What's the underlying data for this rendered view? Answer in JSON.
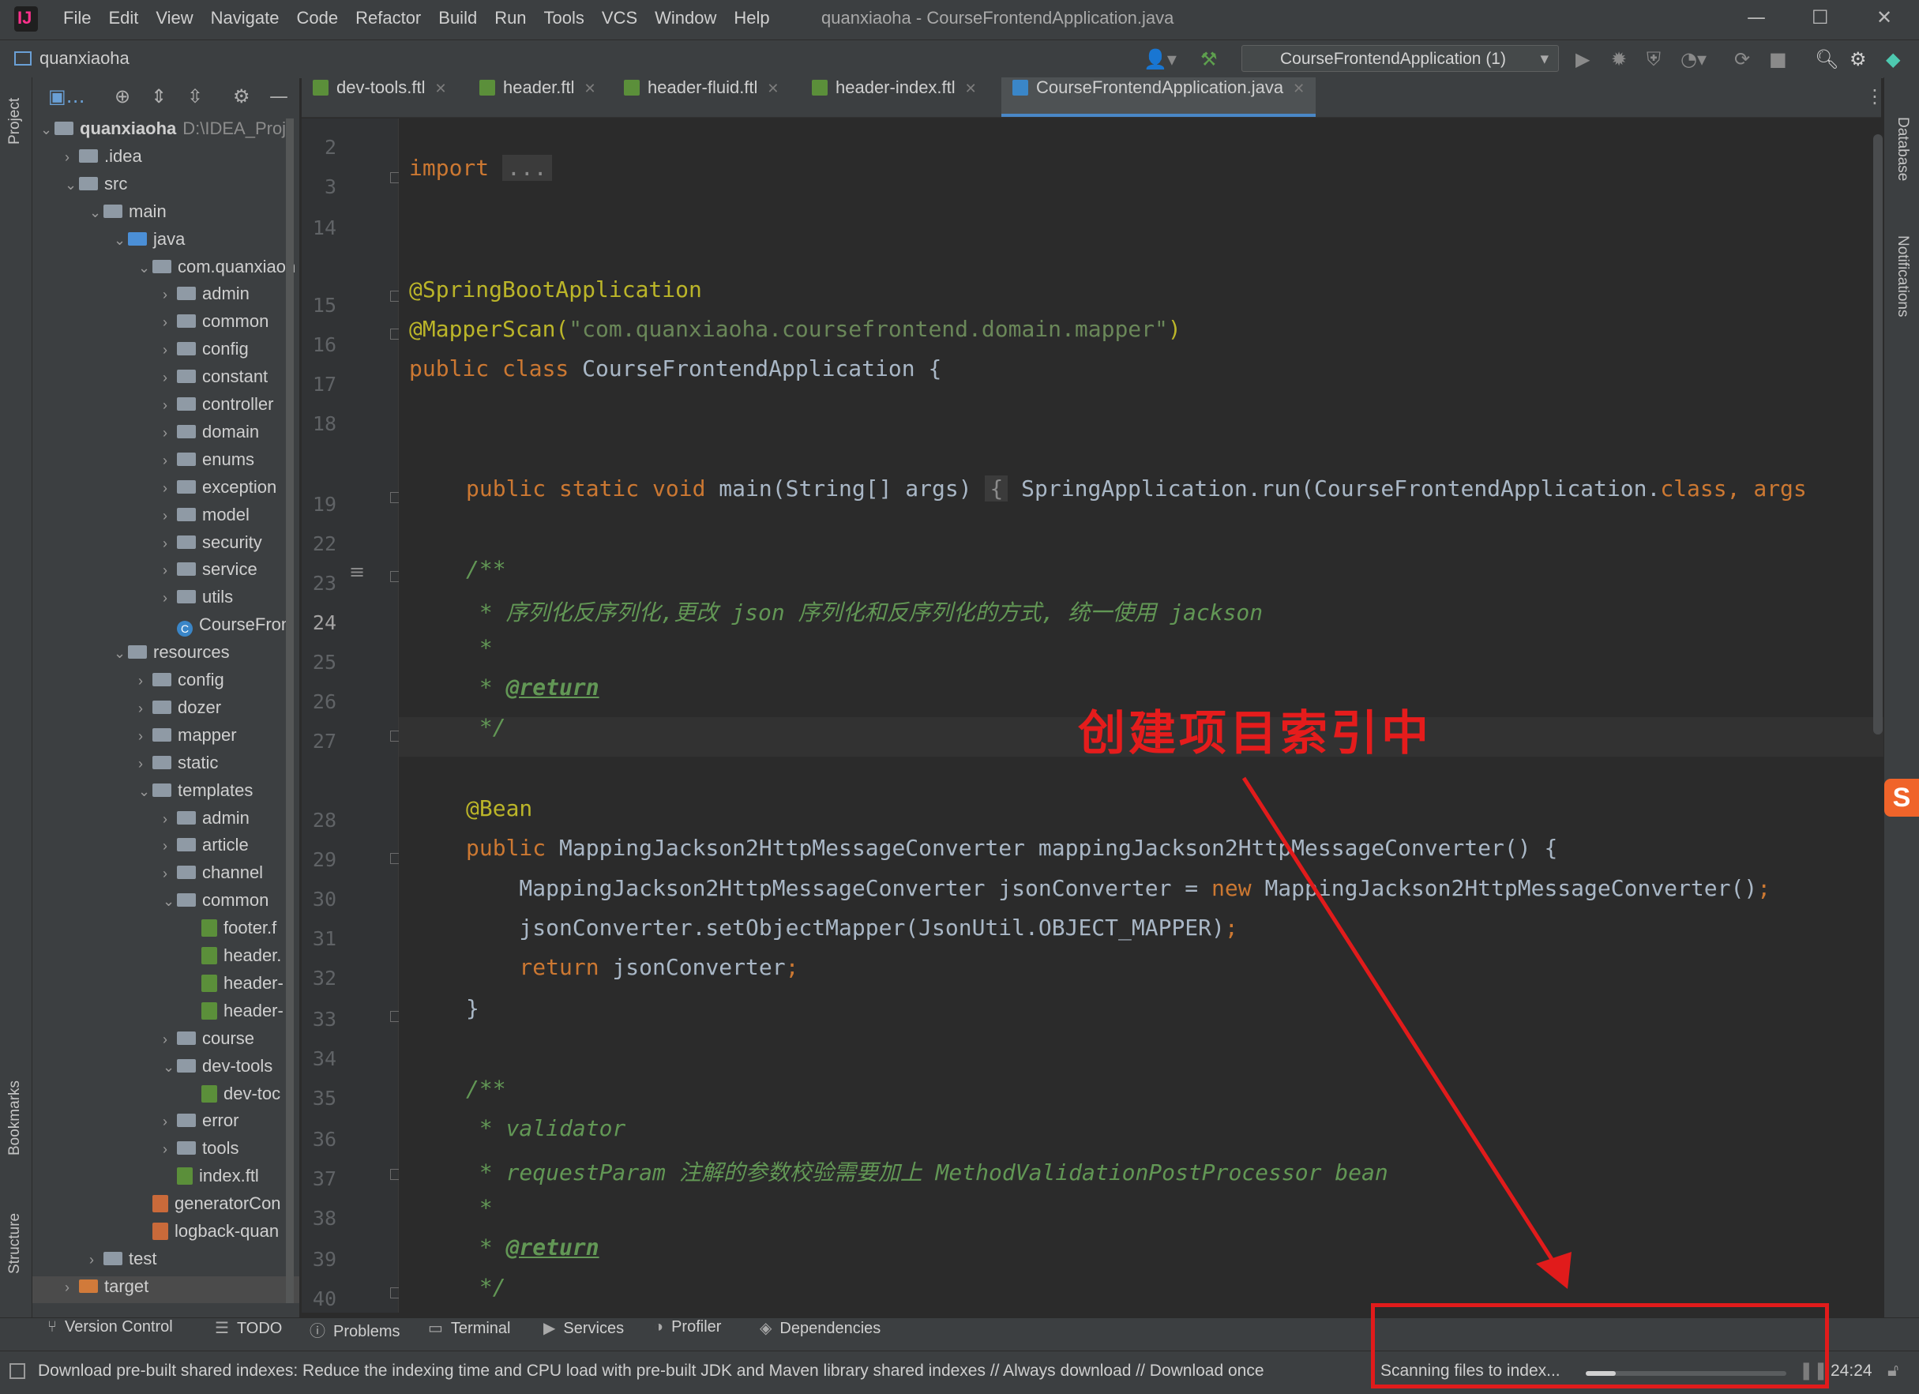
{
  "window": {
    "title": "quanxiaoha - CourseFrontendApplication.java",
    "menu": [
      "File",
      "Edit",
      "View",
      "Navigate",
      "Code",
      "Refactor",
      "Build",
      "Run",
      "Tools",
      "VCS",
      "Window",
      "Help"
    ],
    "controls": {
      "minimize": "—",
      "maximize": "☐",
      "close": "✕"
    }
  },
  "navbar": {
    "project": "quanxiaoha",
    "run_config": "CourseFrontendApplication (1)"
  },
  "left_strip": {
    "project": "Project",
    "bookmarks": "Bookmarks",
    "structure": "Structure"
  },
  "right_strip": {
    "database": "Database",
    "notifications": "Notifications"
  },
  "project_tree": {
    "root_name": "quanxiaoha",
    "root_path": "D:\\IDEA_Proj",
    "rows": [
      {
        "label": ".idea"
      },
      {
        "label": "src"
      },
      {
        "label": "main"
      },
      {
        "label": "java"
      },
      {
        "label": "com.quanxiaoh"
      },
      {
        "label": "admin"
      },
      {
        "label": "common"
      },
      {
        "label": "config"
      },
      {
        "label": "constant"
      },
      {
        "label": "controller"
      },
      {
        "label": "domain"
      },
      {
        "label": "enums"
      },
      {
        "label": "exception"
      },
      {
        "label": "model"
      },
      {
        "label": "security"
      },
      {
        "label": "service"
      },
      {
        "label": "utils"
      },
      {
        "label": "CourseFron"
      },
      {
        "label": "resources"
      },
      {
        "label": "config"
      },
      {
        "label": "dozer"
      },
      {
        "label": "mapper"
      },
      {
        "label": "static"
      },
      {
        "label": "templates"
      },
      {
        "label": "admin"
      },
      {
        "label": "article"
      },
      {
        "label": "channel"
      },
      {
        "label": "common"
      },
      {
        "label": "footer.f"
      },
      {
        "label": "header."
      },
      {
        "label": "header-"
      },
      {
        "label": "header-"
      },
      {
        "label": "course"
      },
      {
        "label": "dev-tools"
      },
      {
        "label": "dev-toc"
      },
      {
        "label": "error"
      },
      {
        "label": "tools"
      },
      {
        "label": "index.ftl"
      },
      {
        "label": "generatorCon"
      },
      {
        "label": "logback-quan"
      },
      {
        "label": "test"
      },
      {
        "label": "target"
      }
    ]
  },
  "tabs": [
    {
      "label": "dev-tools.ftl"
    },
    {
      "label": "header.ftl"
    },
    {
      "label": "header-fluid.ftl"
    },
    {
      "label": "header-index.ftl"
    },
    {
      "label": "CourseFrontendApplication.java"
    }
  ],
  "code": {
    "line_numbers": [
      "2",
      "3",
      "14",
      "15",
      "16",
      "17",
      "18",
      "19",
      "22",
      "23",
      "24",
      "25",
      "26",
      "27",
      "28",
      "29",
      "30",
      "31",
      "32",
      "33",
      "34",
      "35",
      "36",
      "37",
      "38",
      "39",
      "40"
    ],
    "l3_kw": "import",
    "l3_fold": "...",
    "l15": "@SpringBootApplication",
    "l16_ann": "@MapperScan(",
    "l16_str": "\"com.quanxiaoha.coursefrontend.domain.mapper\"",
    "l16_end": ")",
    "l17_kw": "public class ",
    "l17_rest": "CourseFrontendApplication {",
    "l19_kw": "public static void ",
    "l19_sig": "main(String[] args) ",
    "l19_brace": "{",
    "l19_body": " SpringApplication.run(CourseFrontendApplication.",
    "l19_kw2": "class",
    "l19_tail": ", args",
    "l23": "/**",
    "l24": " * 序列化反序列化,更改 json 序列化和反序列化的方式, 统一使用 jackson",
    "l25": " *",
    "l26_a": " * ",
    "l26_tag": "@return",
    "l27": " */",
    "l28": "@Bean",
    "l29_kw": "public ",
    "l29_rest": "MappingJackson2HttpMessageConverter mappingJackson2HttpMessageConverter() {",
    "l30_a": "    MappingJackson2HttpMessageConverter jsonConverter = ",
    "l30_kw": "new ",
    "l30_b": "MappingJackson2HttpMessageConverter()",
    "l30_semi": ";",
    "l31_a": "    jsonConverter.setObjectMapper(JsonUtil.OBJECT_MAPPER)",
    "l31_semi": ";",
    "l32_kw": "    return ",
    "l32_b": "jsonConverter",
    "l32_semi": ";",
    "l33": "}",
    "l35": "/**",
    "l36": " * validator",
    "l37": " * requestParam 注解的参数校验需要加上 MethodValidationPostProcessor bean",
    "l38": " *",
    "l39_a": " * ",
    "l39_tag": "@return",
    "l40": " */"
  },
  "annotation_text": "创建项目索引中",
  "bottom_tabs": [
    "Version Control",
    "TODO",
    "Problems",
    "Terminal",
    "Services",
    "Profiler",
    "Dependencies"
  ],
  "status": {
    "message": "Download pre-built shared indexes: Reduce the indexing time and CPU load with pre-built JDK and Maven library shared indexes // Always download // Download once",
    "indexing": "Scanning files to index...",
    "progress": 0.15,
    "cursor": "24:24"
  },
  "colors": {
    "annotation_red": "#e51c1c",
    "accent_blue": "#4a88c7"
  }
}
